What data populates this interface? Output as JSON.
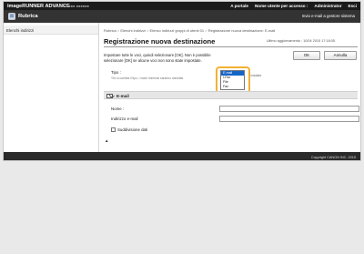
{
  "header": {
    "brand": "imageRUNNER ADVANCE",
    "device_name": "■■■■■ ■■■■ ■■■■■■",
    "nav": [
      "A portale",
      "Nome utente per accesso :",
      "Administrator",
      "Esci"
    ]
  },
  "titlebar": {
    "title": "Rubrica",
    "send_button": "Invio e-mail a gestore sistema"
  },
  "sidebar": {
    "items": [
      {
        "label": "Elenchi indirizzi"
      }
    ]
  },
  "breadcrumb": [
    "Rubrica",
    "Elenchi indirizzi",
    "Elenco indirizzi gruppi di utenti 01",
    "Registrazione nuova destinazione: E-mail"
  ],
  "page": {
    "title": "Registrazione nuova destinazione",
    "last_updated": "Ultimo aggiornamento : 10/04 2015 17:18:05",
    "ok_label": "OK",
    "cancel_label": "Annulla",
    "info_text": "Impostare tutte le voci, quindi selezionare [OK]. Non è possibile selezionare [OK] se alcune voci non sono state impostate."
  },
  "type_row": {
    "label": "Tipo :",
    "note": "*Se si cambia il tipo, i valori immessi saranno annullati.",
    "suffix": "impostato",
    "options": [
      "E-mail",
      "I-Fax",
      "File",
      "Fax"
    ],
    "selected": "E-mail"
  },
  "email_panel": {
    "title": "E-mail",
    "name_label": "Nome :",
    "address_label": "Indirizzo e-mail",
    "name_value": "",
    "address_value": "",
    "split_label": "Suddivisione dati",
    "split_checked": false
  },
  "back_to_top": "▲",
  "footer": {
    "copyright": "Copyright CANON INC. 2015"
  },
  "colors": {
    "highlight": "#f2b233",
    "selected_option": "#1565c8",
    "topbar": "#1b1b1b"
  }
}
